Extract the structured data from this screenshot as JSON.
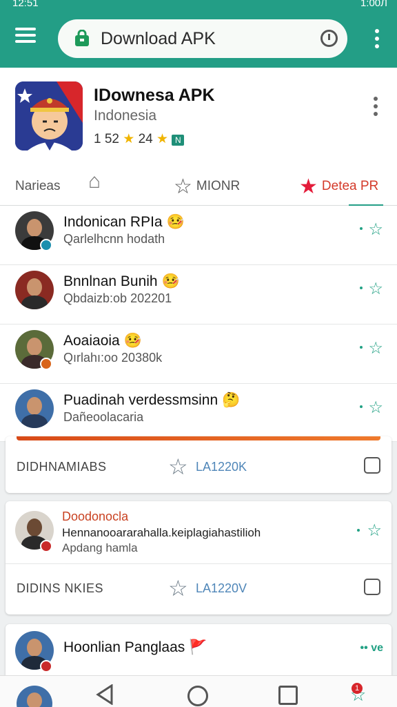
{
  "status": {
    "time": "12:51",
    "indicators": "1:00Л"
  },
  "toolbar": {
    "title": "Download APK"
  },
  "app": {
    "name": "IDownesa APK",
    "developer": "Indonesia",
    "meta_rating": "1 52",
    "meta_reviews": "24",
    "badge_text": "N"
  },
  "tabs": [
    {
      "label": "Narieas"
    },
    {
      "label": "MIONR"
    },
    {
      "label": "Detea PR"
    }
  ],
  "list": [
    {
      "name": "Indonican RPIa",
      "sub": "Qarlelhcnn hodath",
      "emoji": "🤒",
      "badge_color": "#1b8fae"
    },
    {
      "name": "Bnnlnan Bunih",
      "sub": "Qbdaizb:ob 202201",
      "emoji": "🤒",
      "badge_color": "#7b2c22"
    },
    {
      "name": "Aoaiaoia",
      "sub": "Qırlahı:oo 20380k",
      "emoji": "🤒",
      "badge_color": "#d8641a"
    },
    {
      "name": "Puadinah verdessmsinn",
      "sub": "Dañeoolacaria",
      "emoji": "🤔",
      "badge_color": "#2b5b8a"
    }
  ],
  "card1": {
    "label": "DIDHNAMIABS",
    "stat": "LA1220K"
  },
  "card2": {
    "title": "Doodonocla",
    "text": "Hennanooararahalla.keiplagiahastilioh",
    "sub": "Apdang hamla",
    "footer_label": "DIDINS NKIES",
    "footer_stat": "LA1220V"
  },
  "card3": {
    "name": "Hoonlian Panglaas",
    "emoji": "🚩",
    "action": "•• ve"
  },
  "nav": {
    "notif_count": "1"
  }
}
